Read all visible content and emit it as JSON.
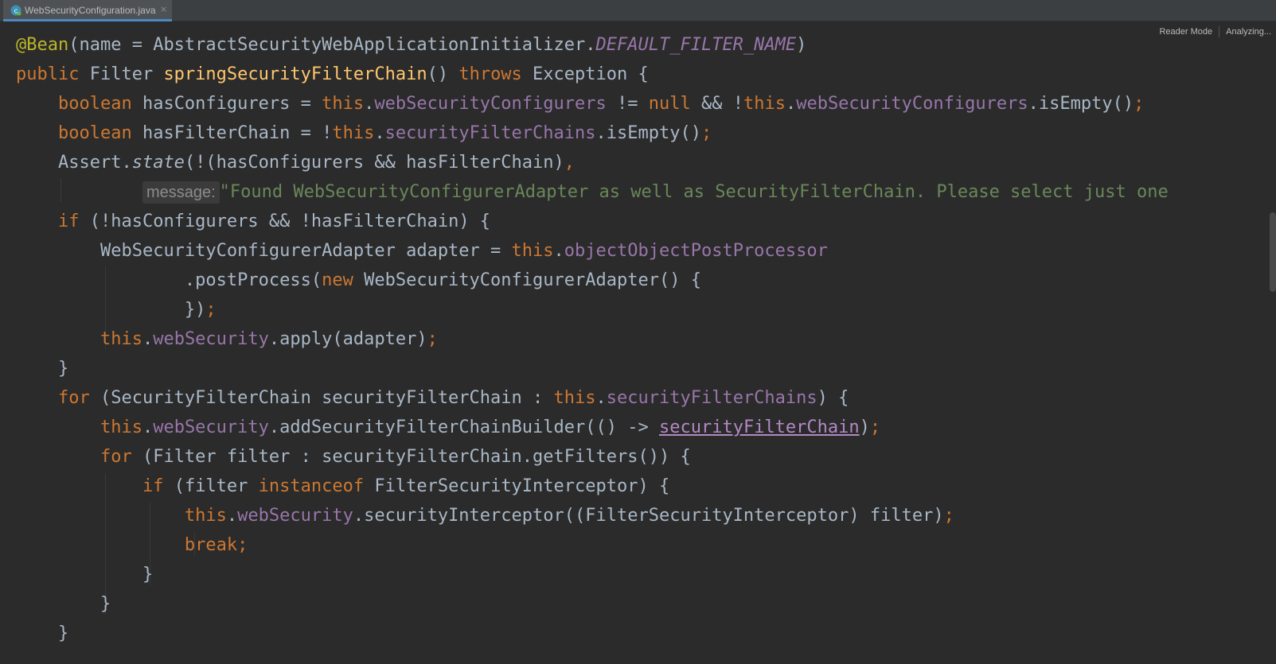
{
  "tab": {
    "title": "WebSecurityConfiguration.java",
    "close_glyph": "×"
  },
  "toolbar": {
    "reader_mode": "Reader Mode",
    "status": "Analyzing..."
  },
  "code": {
    "l1": {
      "a": "@Bean",
      "b": "(name = AbstractSecurityWebApplicationInitializer.",
      "c": "DEFAULT_FILTER_NAME",
      "d": ")"
    },
    "l2": {
      "a": "public ",
      "b": "Filter ",
      "c": "springSecurityFilterChain",
      "d": "() ",
      "e": "throws ",
      "f": "Exception {"
    },
    "l3": {
      "a": "boolean ",
      "b": "hasConfigurers = ",
      "c": "this",
      "d": ".",
      "e": "webSecurityConfigurers",
      "f": " != ",
      "g": "null",
      "h": " && !",
      "i": "this",
      "j": ".",
      "k": "webSecurityConfigurers",
      "l": ".isEmpty()",
      "m": ";"
    },
    "l4": {
      "a": "boolean ",
      "b": "hasFilterChain = !",
      "c": "this",
      "d": ".",
      "e": "securityFilterChains",
      "f": ".isEmpty()",
      "g": ";"
    },
    "l5": {
      "a": "Assert.",
      "b": "state",
      "c": "(!(hasConfigurers && hasFilterChain)",
      "d": ","
    },
    "l6": {
      "hint": "message:",
      "str": "\"Found WebSecurityConfigurerAdapter as well as SecurityFilterChain. Please select just one"
    },
    "l7": {
      "a": "if ",
      "b": "(!hasConfigurers && !hasFilterChain) {"
    },
    "l8": {
      "a": "WebSecurityConfigurerAdapter adapter = ",
      "b": "this",
      "c": ".",
      "d": "objectObjectPostProcessor"
    },
    "l9": {
      "a": ".postProcess(",
      "b": "new ",
      "c": "WebSecurityConfigurerAdapter() {"
    },
    "l10": {
      "a": "})",
      "b": ";"
    },
    "l11": {
      "a": "this",
      "b": ".",
      "c": "webSecurity",
      "d": ".apply(adapter)",
      "e": ";"
    },
    "l12": {
      "a": "}"
    },
    "l13": {
      "a": "for ",
      "b": "(SecurityFilterChain securityFilterChain : ",
      "c": "this",
      "d": ".",
      "e": "securityFilterChains",
      "f": ") {"
    },
    "l14": {
      "a": "this",
      "b": ".",
      "c": "webSecurity",
      "d": ".addSecurityFilterChainBuilder(() -> ",
      "e": "securityFilterChain",
      "f": ")",
      "g": ";"
    },
    "l15": {
      "a": "for ",
      "b": "(Filter filter : securityFilterChain.getFilters()) {"
    },
    "l16": {
      "a": "if ",
      "b": "(filter ",
      "c": "instanceof ",
      "d": "FilterSecurityInterceptor) {"
    },
    "l17": {
      "a": "this",
      "b": ".",
      "c": "webSecurity",
      "d": ".securityInterceptor((FilterSecurityInterceptor) filter)",
      "e": ";"
    },
    "l18": {
      "a": "break",
      "b": ";"
    },
    "l19": {
      "a": "}"
    },
    "l20": {
      "a": "}"
    },
    "l21": {
      "a": "}"
    }
  }
}
